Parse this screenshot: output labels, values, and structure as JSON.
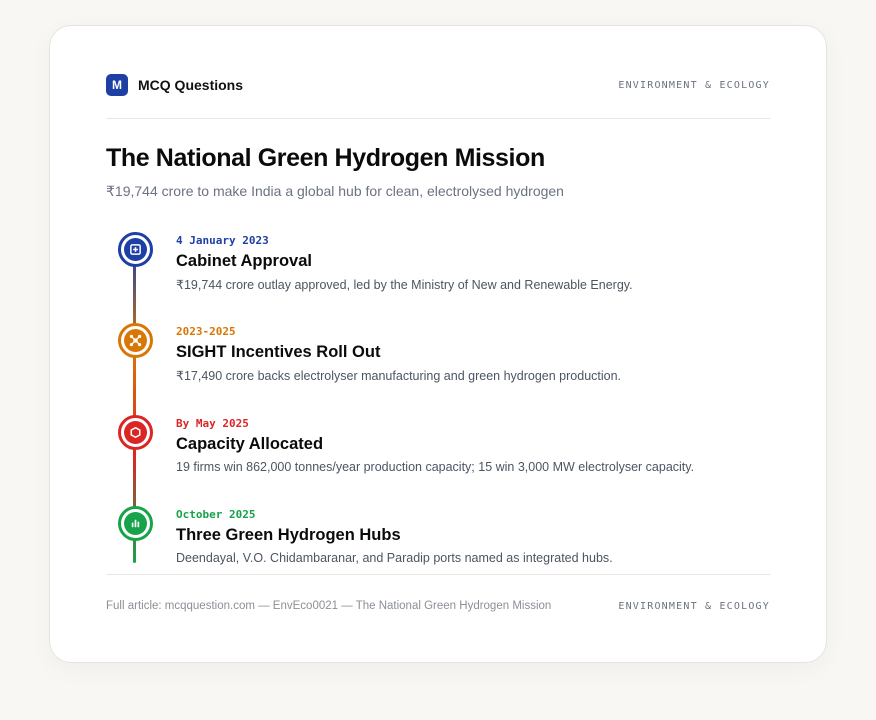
{
  "header": {
    "logo_letter": "M",
    "brand": "MCQ Questions",
    "category": "ENVIRONMENT & ECOLOGY"
  },
  "title": "The National Green Hydrogen Mission",
  "subtitle": "₹19,744 crore to make India a global hub for clean, electrolysed hydrogen",
  "colors": {
    "brand": "#1e3fa3",
    "approval": "#1e3fa3",
    "incentives": "#d97706",
    "capacity": "#dc2626",
    "hubs": "#16a34a"
  },
  "events": [
    {
      "date": "4 January 2023",
      "title": "Cabinet Approval",
      "description": "₹19,744 crore outlay approved, led by the Ministry of New and Renewable Energy.",
      "icon": "plus-square-icon"
    },
    {
      "date": "2023-2025",
      "title": "SIGHT Incentives Roll Out",
      "description": "₹17,490 crore backs electrolyser manufacturing and green hydrogen production.",
      "icon": "network-icon"
    },
    {
      "date": "By May 2025",
      "title": "Capacity Allocated",
      "description": "19 firms win 862,000 tonnes/year production capacity; 15 win 3,000 MW electrolyser capacity.",
      "icon": "hexagon-icon"
    },
    {
      "date": "October 2025",
      "title": "Three Green Hydrogen Hubs",
      "description": "Deendayal, V.O. Chidambaranar, and Paradip ports named as integrated hubs.",
      "icon": "bar-chart-icon"
    }
  ],
  "footer": {
    "note": "Full article: mcqquestion.com — EnvEco0021 — The National Green Hydrogen Mission",
    "category": "ENVIRONMENT & ECOLOGY"
  }
}
